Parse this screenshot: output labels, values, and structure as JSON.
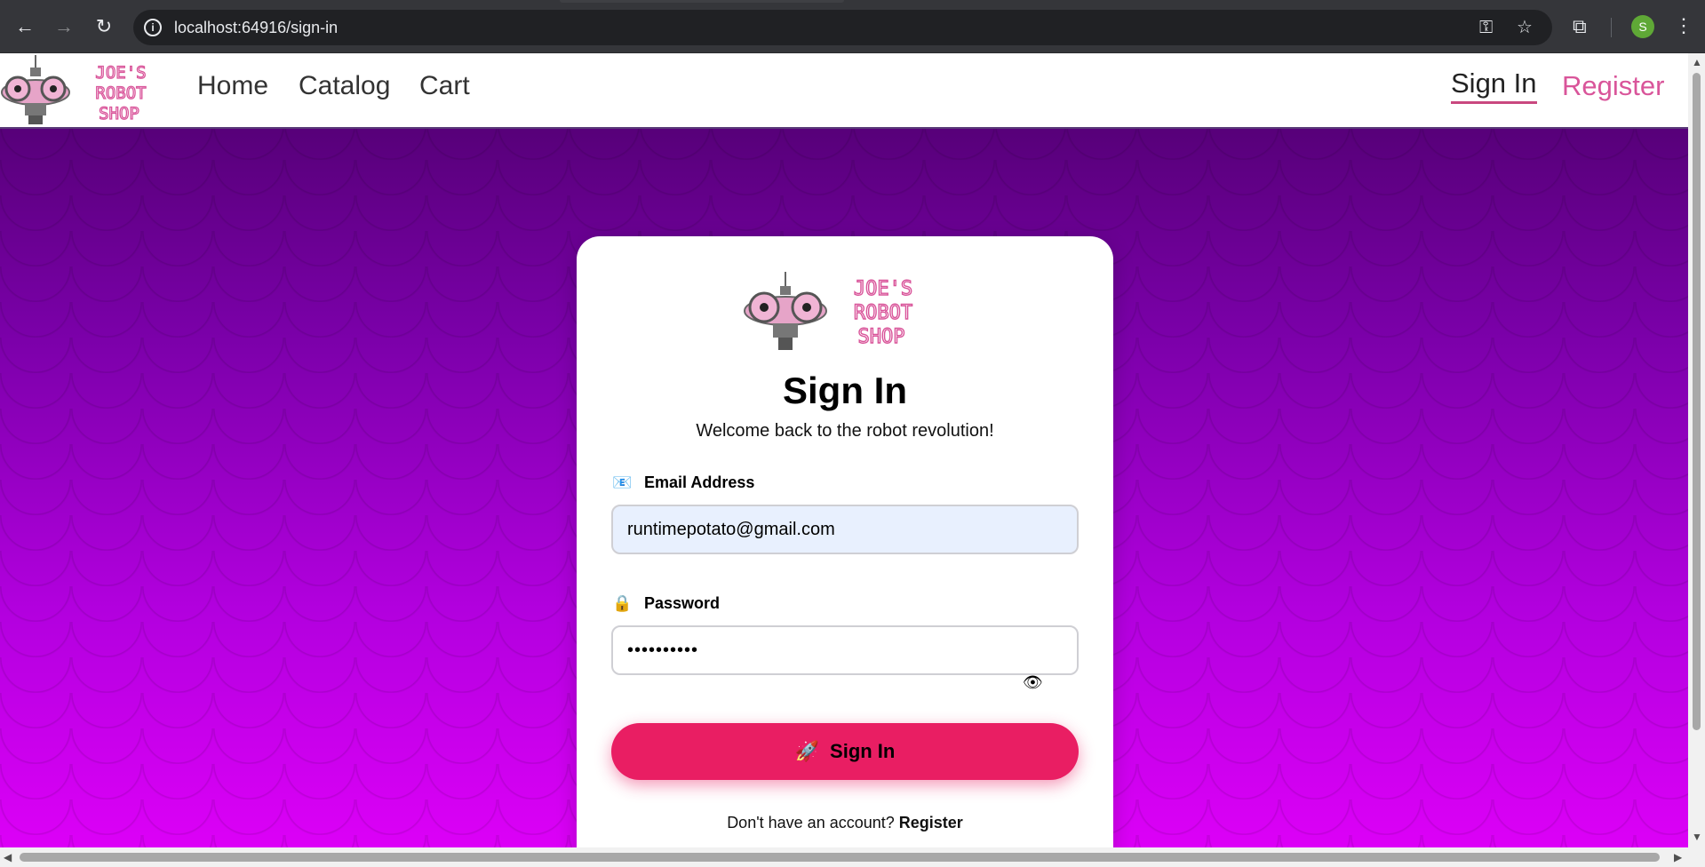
{
  "browser": {
    "url": "localhost:64916/sign-in",
    "profile_initial": "S"
  },
  "header": {
    "logo_text": [
      "JOE'S",
      "ROBOT",
      "SHOP"
    ],
    "nav": [
      "Home",
      "Catalog",
      "Cart"
    ],
    "sign_in": "Sign In",
    "register": "Register"
  },
  "card": {
    "logo_text": [
      "JOE'S",
      "ROBOT",
      "SHOP"
    ],
    "title": "Sign In",
    "subtitle": "Welcome back to the robot revolution!",
    "email": {
      "label": "Email Address",
      "icon": "📧",
      "value": "runtimepotato@gmail.com"
    },
    "password": {
      "label": "Password",
      "icon": "🔒",
      "masked_value": "••••••••••",
      "toggle_icon": "👁"
    },
    "submit": {
      "icon": "🚀",
      "label": "Sign In"
    },
    "footer_prompt": "Don't have an account?",
    "footer_link": "Register"
  },
  "colors": {
    "accent_pink": "#e91e63",
    "link_pink": "#d9559a",
    "bg_top": "#4a0068",
    "bg_bottom": "#dc00f7"
  }
}
